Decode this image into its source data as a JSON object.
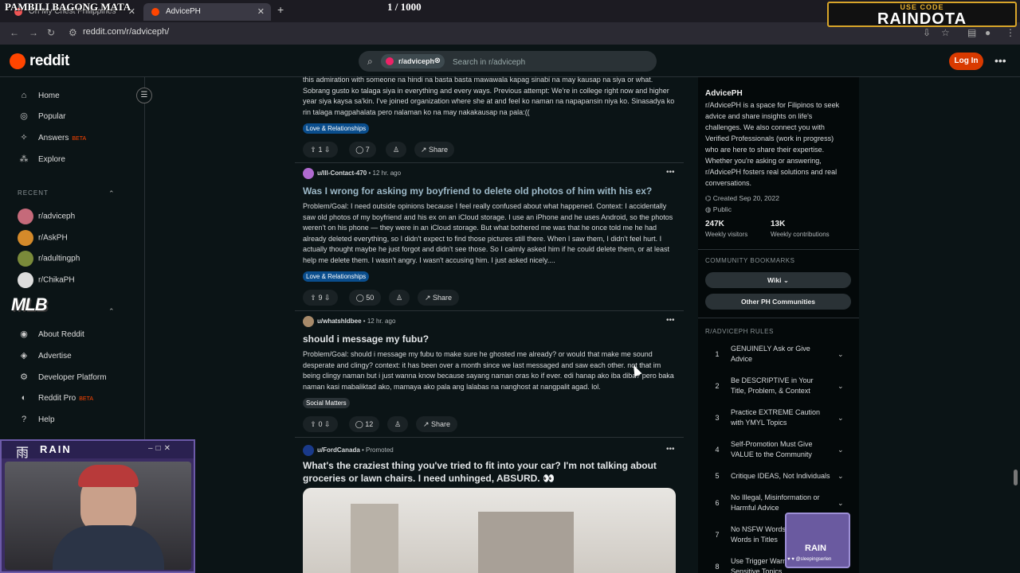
{
  "overlay": {
    "title": "PAMBILI BAGONG MATA",
    "counter": "1   / 1000",
    "promo_small": "USE CODE",
    "promo_big": "RAINDOTA",
    "mlb": "MLB",
    "cam_title": "RAIN",
    "cam_kanji": "雨",
    "badge_text": "RAIN",
    "badge_handle": "♥ ♥ @sleepingserlen"
  },
  "browser": {
    "tab1": "Oh My Chest Philippines",
    "tab2": "AdvicePH",
    "url": "reddit.com/r/adviceph/"
  },
  "header": {
    "logo": "reddit",
    "chip": "r/adviceph",
    "search_placeholder": "Search in r/adviceph",
    "login": "Log In"
  },
  "sidebar": {
    "home": "Home",
    "popular": "Popular",
    "answers": "Answers",
    "beta": "BETA",
    "explore": "Explore",
    "recent_label": "RECENT",
    "recent": [
      "r/adviceph",
      "r/AskPH",
      "r/adultingph",
      "r/ChikaPH"
    ],
    "about": "About Reddit",
    "advertise": "Advertise",
    "developer": "Developer Platform",
    "reddit_pro": "Reddit Pro",
    "help": "Help"
  },
  "posts": [
    {
      "body": "this admiration with someone na hindi na basta basta mawawala kapag sinabi na may kausap na siya or what. Sobrang gusto ko talaga siya in everything and every ways. Previous attempt: We're in college right now and higher year siya kaysa sa'kin. I've joined organization where she at and feel ko naman na napapansin niya ko. Sinasadya ko rin talaga magpahalata pero nalaman ko na may nakakausap na pala:((",
      "flair": "Love & Relationships",
      "votes": "1",
      "comments": "7",
      "share": "Share"
    },
    {
      "author": "u/Ill-Contact-470",
      "time": "• 12 hr. ago",
      "title": "Was I wrong for asking my boyfriend to delete old photos of him with his ex?",
      "body": "Problem/Goal: I need outside opinions because I feel really confused about what happened. Context: I accidentally saw old photos of my boyfriend and his ex on an iCloud storage. I use an iPhone and he uses Android, so the photos weren't on his phone — they were in an iCloud storage. But what bothered me was that he once told me he had already deleted everything, so I didn't expect to find those pictures still there. When I saw them, I didn't feel hurt. I actually thought maybe he just forgot and didn't see those. So I calmly asked him if he could delete them, or at least help me delete them. I wasn't angry. I wasn't accusing him. I just asked nicely....",
      "flair": "Love & Relationships",
      "votes": "9",
      "comments": "50",
      "share": "Share"
    },
    {
      "author": "u/whatshldbee",
      "time": "• 12 hr. ago",
      "title": "should i message my fubu?",
      "body": "Problem/Goal: should i message my fubu to make sure he ghosted me already? or would that make me sound desperate and clingy? context: it has been over a month since we last messaged and saw each other. not that im being clingy naman but i just wanna know because sayang naman oras ko if ever. edi hanap ako iba diba? pero baka naman kasi mabaliktad ako, mamaya ako pala ang lalabas na nanghost at nangpalit agad. lol.",
      "flair": "Social Matters",
      "votes": "0",
      "comments": "12",
      "share": "Share"
    },
    {
      "author": "u/FordCanada",
      "time": "• Promoted",
      "title": "What's the craziest thing you've tried to fit into your car? I'm not talking about groceries or lawn chairs. I need unhinged, ABSURD. 👀"
    }
  ],
  "community": {
    "name": "AdvicePH",
    "description": "r/AdvicePH is a space for Filipinos to seek advice and share insights on life's challenges. We also connect you with Verified Professionals (work in progress) who are here to share their expertise. Whether you're asking or answering, r/AdvicePH fosters real solutions and real conversations.",
    "created": "Created Sep 20, 2022",
    "visibility": "Public",
    "visitors": "247K",
    "visitors_label": "Weekly visitors",
    "contributions": "13K",
    "contributions_label": "Weekly contributions",
    "bookmarks_label": "COMMUNITY BOOKMARKS",
    "wiki": "Wiki",
    "other": "Other PH Communities",
    "rules_label": "R/ADVICEPH RULES",
    "rules": [
      {
        "num": "1",
        "text": "GENUINELY Ask or Give Advice"
      },
      {
        "num": "2",
        "text": "Be DESCRIPTIVE in Your Title, Problem, & Context"
      },
      {
        "num": "3",
        "text": "Practice EXTREME Caution with YMYL Topics"
      },
      {
        "num": "4",
        "text": "Self-Promotion Must Give VALUE to the Community"
      },
      {
        "num": "5",
        "text": "Critique IDEAS, Not Individuals"
      },
      {
        "num": "6",
        "text": "No Illegal, Misinformation or Harmful Advice"
      },
      {
        "num": "7",
        "text": "No NSFW Words or Sexual Words in Titles"
      },
      {
        "num": "8",
        "text": "Use Trigger Warnings for Sensitive Topics"
      }
    ]
  },
  "colors": {
    "accent": "#ff4500",
    "login": "#d93a00",
    "flair_love": "#0a4d8c",
    "flair_social": "#2a3236",
    "link_title": "#9db9c8"
  }
}
